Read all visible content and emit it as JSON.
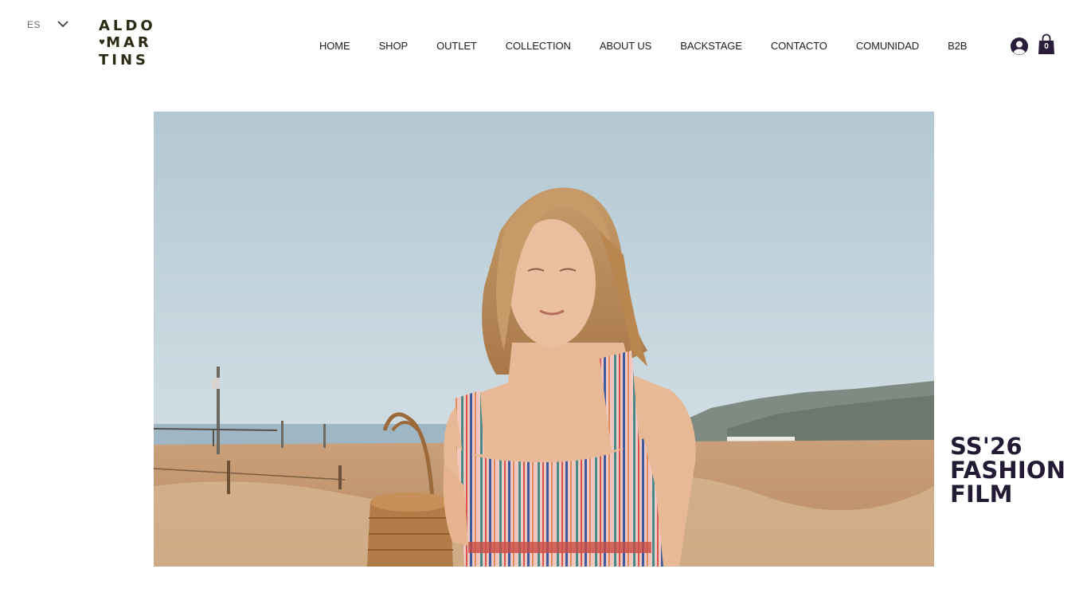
{
  "language": {
    "current": "ES"
  },
  "logo": {
    "lines": [
      "ALDO",
      "MAR",
      "TINS"
    ],
    "heart": "♥"
  },
  "nav": {
    "items": [
      "HOME",
      "SHOP",
      "OUTLET",
      "COLLECTION",
      "ABOUT US",
      "BACKSTAGE",
      "CONTACTO",
      "COMUNIDAD",
      "B2B"
    ]
  },
  "cart": {
    "count": "0"
  },
  "hero": {
    "title_lines": [
      "SS'26",
      "FASHION",
      "FILM"
    ]
  },
  "colors": {
    "logo": "#2b2a12",
    "title": "#231a33",
    "icons": "#2a1d3a"
  }
}
